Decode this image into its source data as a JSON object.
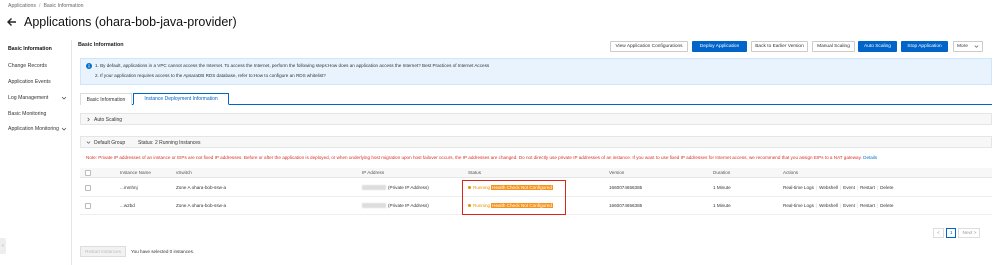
{
  "breadcrumb": [
    "Applications",
    "/",
    "Basic Information"
  ],
  "title": "Applications (ohara-bob-java-provider)",
  "sidebar": {
    "items": [
      {
        "label": "Basic Information",
        "active": true
      },
      {
        "label": "Change Records"
      },
      {
        "label": "Application Events"
      },
      {
        "label": "Log Management",
        "expandable": true
      },
      {
        "label": "Basic Monitoring"
      },
      {
        "label": "Application Monitoring",
        "expandable": true
      }
    ]
  },
  "header": {
    "section_title": "Basic Information",
    "buttons": [
      {
        "label": "View Application Configurations",
        "primary": false
      },
      {
        "label": "Deploy Application",
        "primary": true
      },
      {
        "label": "Back to Earlier Version",
        "primary": false
      },
      {
        "label": "Manual Scaling",
        "primary": false
      },
      {
        "label": "Auto Scaling",
        "primary": true
      },
      {
        "label": "Stop Application",
        "primary": true
      },
      {
        "label": "More",
        "primary": false
      }
    ]
  },
  "notice": {
    "line1": "1. By default, applications in a VPC cannot access the Internet. To access the Internet, perform the following steps:How does an application access the Internet? Best Practices of Internet Access",
    "line2": "2. If your application requires access to the ApsaraDB RDS database, refer to:How to configure an RDS whitelist?"
  },
  "tabs": [
    {
      "label": "Basic Information",
      "active": false
    },
    {
      "label": "Instance Deployment Information",
      "active": true
    }
  ],
  "auto_scaling_label": "Auto Scaling",
  "group": {
    "name": "Default Group",
    "status": "Status: 2 Running Instances"
  },
  "warning": "Note: Private IP addresses of an instance or EIPs are not fixed IP addresses. Before or after the application is deployed, or when underlying host migration upon host failover occurs, the IP addresses are changed. Do not directly use private IP addresses of an instance. If you want to use fixed IP addresses for Internet access, we recommend that you assign EIPs to a NAT gateway.",
  "warning_link": "Details",
  "table": {
    "columns": [
      "Instance Name",
      "vSwitch",
      "IP Address",
      "Status",
      "Version",
      "Duration",
      "Actions"
    ],
    "rows": [
      {
        "name": "...mmhnj",
        "vswitch": "Zone A ohara-bob-ssw-a",
        "ip_suffix": "(Private IP Address)",
        "status": "Running",
        "health": "Health Check Not Configured",
        "version": "1660074656385",
        "duration": "1 Minute"
      },
      {
        "name": "...w2bd",
        "vswitch": "Zone A ohara-bob-ssw-a",
        "ip_suffix": "(Private IP Address)",
        "status": "Running",
        "health": "Health Check Not Configured",
        "version": "1660074656385",
        "duration": "1 Minute"
      }
    ],
    "actions": [
      "Real-time Logs",
      "Webshell",
      "Event",
      "Restart",
      "Delete"
    ]
  },
  "pager": {
    "prev": "<",
    "page": "1",
    "next": "Next >"
  },
  "footer": {
    "button": "Restart Instances",
    "selected_text": "You have selected 0 instances."
  },
  "colors": {
    "primary": "#0064c8",
    "warning": "#d93026",
    "health": "#f7941d"
  }
}
